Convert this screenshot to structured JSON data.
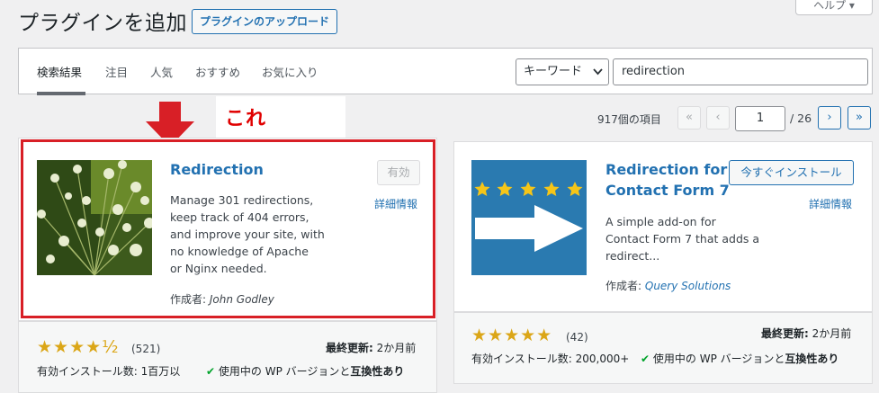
{
  "header": {
    "title": "プラグインを追加",
    "upload_button": "プラグインのアップロード",
    "help_tab": "ヘルプ"
  },
  "filter": {
    "tabs": [
      "検索結果",
      "注目",
      "人気",
      "おすすめ",
      "お気に入り"
    ],
    "search_type": "キーワード",
    "search_value": "redirection"
  },
  "annotation": {
    "note": "これ",
    "arrow_color": "#d81f26"
  },
  "pagination": {
    "items_count": "917個の項目",
    "first": "«",
    "prev": "‹",
    "current_page": "1",
    "total": "/ 26",
    "next": "›",
    "last": "»"
  },
  "plugins": [
    {
      "name": "Redirection",
      "action": "有効",
      "details": "詳細情報",
      "description": [
        "Manage 301 redirections,",
        "keep track of 404 errors,",
        "and improve your site, with",
        "no knowledge of Apache",
        "or Nginx needed."
      ],
      "author_label": "作成者:",
      "author": "John Godley",
      "stars": "★★★★½",
      "rating_count": "(521)",
      "last_updated_label": "最終更新:",
      "last_updated": "2か月前",
      "installs": "有効インストール数: 1百万以",
      "compat_prefix": "使用中の WP バージョンと",
      "compat_strong": "互換性あり"
    },
    {
      "name_line1": "Redirection for",
      "name_line2": "Contact Form 7",
      "action": "今すぐインストール",
      "details": "詳細情報",
      "description": [
        "A simple add-on for",
        "Contact Form 7 that adds a",
        "redirect..."
      ],
      "author_label": "作成者:",
      "author": "Query Solutions",
      "stars": "★★★★★",
      "rating_count": "(42)",
      "last_updated_label": "最終更新:",
      "last_updated": "2か月前",
      "installs": "有効インストール数: 200,000+",
      "compat_prefix": "使用中の WP バージョンと",
      "compat_strong": "互換性あり"
    }
  ],
  "colors": {
    "accent": "#2271b1",
    "star": "#dba617",
    "highlight": "#d81f26",
    "ok": "#00a32a"
  }
}
